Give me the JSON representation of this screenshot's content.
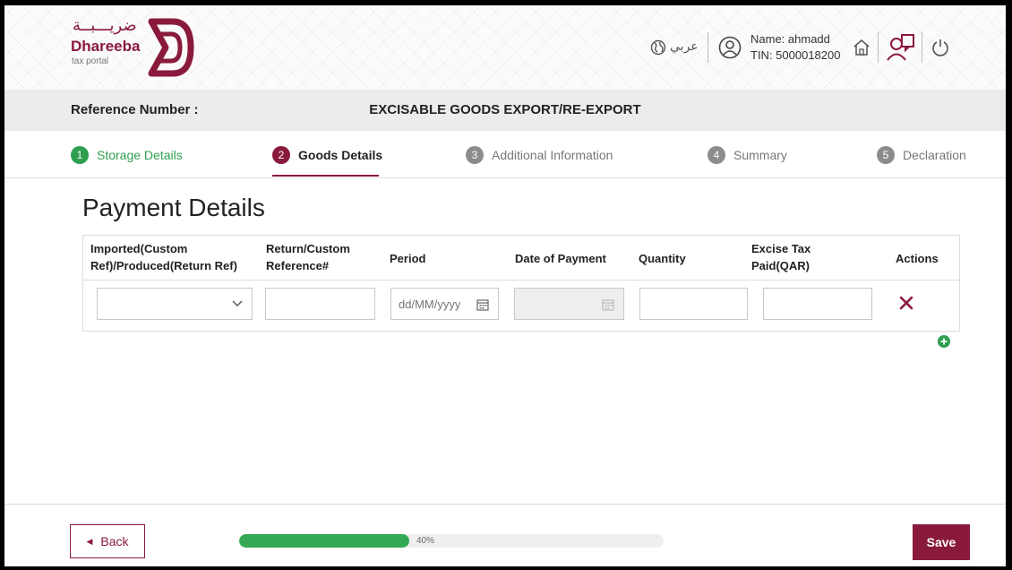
{
  "brand": {
    "arabic_name": "ضريـــبــة",
    "name": "Dhareeba",
    "subtitle": "tax portal",
    "color": "#8a1a3c"
  },
  "header": {
    "language_label": "عربي",
    "user_name": "Name: ahmadd",
    "user_tin": "TIN: 5000018200",
    "icons": [
      "globe-icon",
      "user-icon",
      "home-icon",
      "users-icon",
      "power-icon"
    ]
  },
  "title_band": {
    "reference_label": "Reference Number :",
    "page_title": "EXCISABLE GOODS EXPORT/RE-EXPORT"
  },
  "stepper": {
    "steps": [
      {
        "num": "1",
        "label": "Storage Details",
        "state": "done"
      },
      {
        "num": "2",
        "label": "Goods Details",
        "state": "active"
      },
      {
        "num": "3",
        "label": "Additional Information",
        "state": "todo"
      },
      {
        "num": "4",
        "label": "Summary",
        "state": "todo"
      },
      {
        "num": "5",
        "label": "Declaration",
        "state": "todo"
      }
    ],
    "colors": {
      "done": "#2e9e4f",
      "active": "#8a1a3c",
      "todo": "#8c8c8c"
    }
  },
  "payment": {
    "title": "Payment Details",
    "columns": {
      "imported_line1": "Imported(Custom",
      "imported_line2": "Ref)/Produced(Return Ref)",
      "return_line1": "Return/Custom",
      "return_line2": "Reference#",
      "period": "Period",
      "date_of_payment": "Date of Payment",
      "quantity": "Quantity",
      "excise_line1": "Excise Tax",
      "excise_line2": "Paid(QAR)",
      "actions": "Actions"
    },
    "row": {
      "imported_value": "",
      "return_reference": "",
      "period_placeholder": "dd/MM/yyyy",
      "date_of_payment": "",
      "quantity": "",
      "excise_tax_paid": ""
    }
  },
  "footer": {
    "back_label": "Back",
    "progress_percent": 40,
    "progress_label": "40%",
    "save_label": "Save",
    "progress_color": "#34a853"
  }
}
